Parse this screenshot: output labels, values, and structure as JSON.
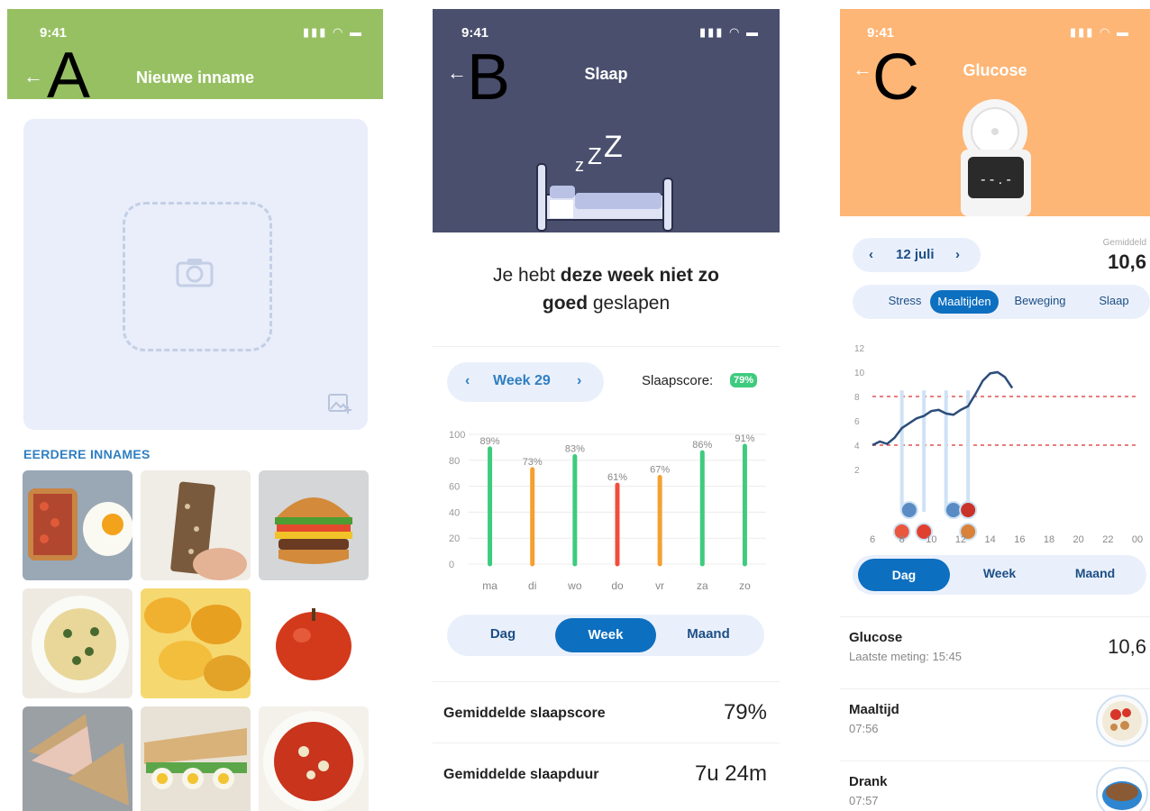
{
  "labels": {
    "a": "A",
    "b": "B",
    "c": "C"
  },
  "status_time": "9:41",
  "phoneA": {
    "title": "Nieuwe inname",
    "section_label": "EERDERE INNAMES",
    "tiles": [
      "toast-egg",
      "granola-bar",
      "burger",
      "pasta",
      "chips",
      "apple",
      "sandwich",
      "egg-sandwich",
      "spaghetti"
    ]
  },
  "phoneB": {
    "title": "Slaap",
    "headline_pre": "Je hebt ",
    "headline_bold1": "deze week niet zo",
    "headline_bold2": "goed",
    "headline_post": " geslapen",
    "week_label": "Week 29",
    "score_label": "Slaapscore:",
    "score_value": "79%",
    "periods": [
      "Dag",
      "Week",
      "Maand"
    ],
    "active_period": "Week",
    "rows": [
      {
        "label": "Gemiddelde slaapscore",
        "value": "79%"
      },
      {
        "label": "Gemiddelde slaapduur",
        "value": "7u 24m"
      }
    ]
  },
  "sleep_chart": {
    "chart_data": {
      "type": "bar",
      "categories": [
        "ma",
        "di",
        "wo",
        "do",
        "vr",
        "za",
        "zo"
      ],
      "values": [
        89,
        73,
        83,
        61,
        67,
        86,
        91
      ],
      "value_labels": [
        "89%",
        "73%",
        "83%",
        "61%",
        "67%",
        "86%",
        "91%"
      ],
      "colors": [
        "#3ecb7e",
        "#f5a030",
        "#3ecb7e",
        "#f04e3e",
        "#f5a030",
        "#3ecb7e",
        "#3ecb7e"
      ],
      "ylim": [
        0,
        100
      ],
      "yticks": [
        "100",
        "80",
        "60",
        "40",
        "20",
        "0"
      ]
    }
  },
  "phoneC": {
    "title": "Glucose",
    "date_label": "12 juli",
    "avg_label": "Gemiddeld",
    "avg_value": "10,6",
    "tabs": [
      "Stress",
      "Maaltijden",
      "Beweging",
      "Slaap"
    ],
    "active_tab": "Maaltijden",
    "periods": [
      "Dag",
      "Week",
      "Maand"
    ],
    "active_period": "Dag",
    "list": [
      {
        "label": "Glucose",
        "sub": "Laatste meting: 15:45",
        "value": "10,6"
      },
      {
        "label": "Maaltijd",
        "sub": "07:56"
      },
      {
        "label": "Drank",
        "sub": "07:57"
      }
    ]
  },
  "glucose_chart": {
    "chart_data": {
      "type": "line",
      "x": [
        6,
        6.5,
        7,
        7.5,
        8,
        8.5,
        9,
        9.5,
        10,
        10.5,
        11,
        11.5,
        12,
        12.5,
        13,
        13.5,
        14,
        14.5,
        15,
        15.5
      ],
      "y": [
        4.0,
        4.3,
        4.1,
        4.6,
        5.4,
        5.8,
        6.2,
        6.4,
        6.8,
        6.9,
        6.6,
        6.5,
        6.9,
        7.2,
        8.2,
        9.3,
        9.9,
        10.0,
        9.6,
        8.7
      ],
      "xticks": [
        "6",
        "8",
        "10",
        "12",
        "14",
        "16",
        "18",
        "20",
        "22",
        "00"
      ],
      "yticks": [
        "12",
        "10",
        "8",
        "6",
        "4",
        "2"
      ],
      "xlim": [
        6,
        24
      ],
      "ylim": [
        0,
        12
      ],
      "threshold_lines": [
        8,
        4
      ],
      "event_times": [
        8,
        9.5,
        11,
        12.5
      ]
    }
  }
}
